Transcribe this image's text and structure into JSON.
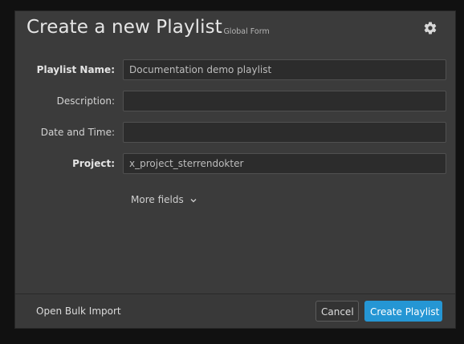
{
  "dialog": {
    "title": "Create a new Playlist",
    "subtitle": "- Global Form",
    "settings_icon": "gear-icon"
  },
  "form": {
    "fields": [
      {
        "label": "Playlist Name:",
        "value": "Documentation demo playlist",
        "required": true
      },
      {
        "label": "Description:",
        "value": "",
        "required": false
      },
      {
        "label": "Date and Time:",
        "value": "",
        "required": false
      },
      {
        "label": "Project:",
        "value": "x_project_sterrendokter",
        "required": true
      }
    ],
    "more_fields_label": "More fields",
    "more_fields_icon": "chevron-down-icon"
  },
  "footer": {
    "bulk_import_label": "Open Bulk Import",
    "cancel_label": "Cancel",
    "create_label": "Create Playlist"
  },
  "colors": {
    "accent": "#2596d4",
    "dialog_bg": "#3b3b3b",
    "input_bg": "#2c2c2c"
  }
}
